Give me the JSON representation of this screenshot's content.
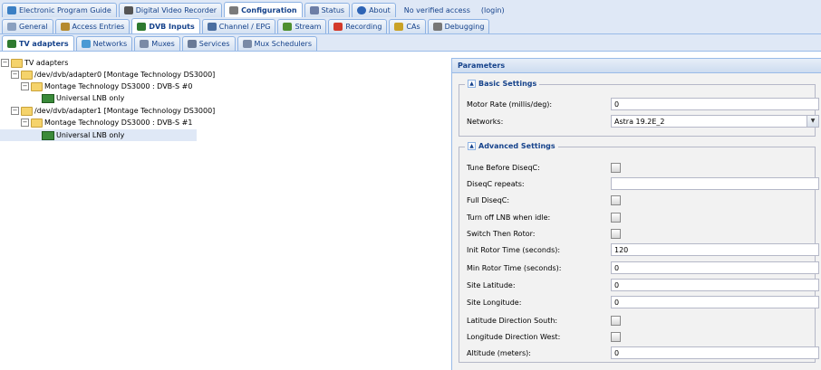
{
  "top_tabs": [
    {
      "label": "Electronic Program Guide",
      "icon": "epg-icon",
      "color": "#3b7fc4"
    },
    {
      "label": "Digital Video Recorder",
      "icon": "dvr-icon",
      "color": "#555555"
    },
    {
      "label": "Configuration",
      "icon": "wrench-icon",
      "color": "#7a7a7a",
      "active": true
    },
    {
      "label": "Status",
      "icon": "status-icon",
      "color": "#6d7ea6"
    },
    {
      "label": "About",
      "icon": "about-icon",
      "color": "#2e64b5"
    }
  ],
  "access_status": "No verified access",
  "login_link": "(login)",
  "config_tabs": [
    {
      "label": "General",
      "icon": "general-icon",
      "color": "#8aa0c0"
    },
    {
      "label": "Access Entries",
      "icon": "access-icon",
      "color": "#b58a2e"
    },
    {
      "label": "DVB Inputs",
      "icon": "dvb-icon",
      "color": "#2f7a2f",
      "active": true
    },
    {
      "label": "Channel / EPG",
      "icon": "channel-icon",
      "color": "#4c6fa0"
    },
    {
      "label": "Stream",
      "icon": "stream-icon",
      "color": "#4f8f2f"
    },
    {
      "label": "Recording",
      "icon": "recording-icon",
      "color": "#d33a2a"
    },
    {
      "label": "CAs",
      "icon": "key-icon",
      "color": "#c9a227"
    },
    {
      "label": "Debugging",
      "icon": "debug-icon",
      "color": "#777777"
    }
  ],
  "dvb_tabs": [
    {
      "label": "TV adapters",
      "icon": "tv-adapter-icon",
      "color": "#2f7a2f",
      "active": true
    },
    {
      "label": "Networks",
      "icon": "network-icon",
      "color": "#4a9ad4"
    },
    {
      "label": "Muxes",
      "icon": "muxes-icon",
      "color": "#7a8aa6"
    },
    {
      "label": "Services",
      "icon": "services-icon",
      "color": "#6a7a96"
    },
    {
      "label": "Mux Schedulers",
      "icon": "scheduler-icon",
      "color": "#7a8aa6"
    }
  ],
  "tree": {
    "root": "TV adapters",
    "adapter0": "/dev/dvb/adapter0 [Montage Technology DS3000]",
    "frontend0": "Montage Technology DS3000 : DVB-S #0",
    "lnb0": "Universal LNB only",
    "adapter1": "/dev/dvb/adapter1 [Montage Technology DS3000]",
    "frontend1": "Montage Technology DS3000 : DVB-S #1",
    "lnb1": "Universal LNB only"
  },
  "params": {
    "title": "Parameters",
    "basic": {
      "legend": "Basic Settings",
      "motor_rate_label": "Motor Rate (millis/deg):",
      "motor_rate_value": "0",
      "networks_label": "Networks:",
      "networks_value": "Astra 19.2E_2"
    },
    "advanced": {
      "legend": "Advanced Settings",
      "tune_before_label": "Tune Before DiseqC:",
      "diseqc_repeats_label": "DiseqC repeats:",
      "diseqc_repeats_value": "",
      "full_diseqc_label": "Full DiseqC:",
      "turn_off_lnb_label": "Turn off LNB when idle:",
      "switch_then_rotor_label": "Switch Then Rotor:",
      "init_rotor_label": "Init Rotor Time (seconds):",
      "init_rotor_value": "120",
      "min_rotor_label": "Min Rotor Time (seconds):",
      "min_rotor_value": "0",
      "site_lat_label": "Site Latitude:",
      "site_lat_value": "0",
      "site_lon_label": "Site Longitude:",
      "site_lon_value": "0",
      "lat_south_label": "Latitude Direction South:",
      "lon_west_label": "Longitude Direction West:",
      "altitude_label": "Altitude (meters):",
      "altitude_value": "0"
    }
  }
}
